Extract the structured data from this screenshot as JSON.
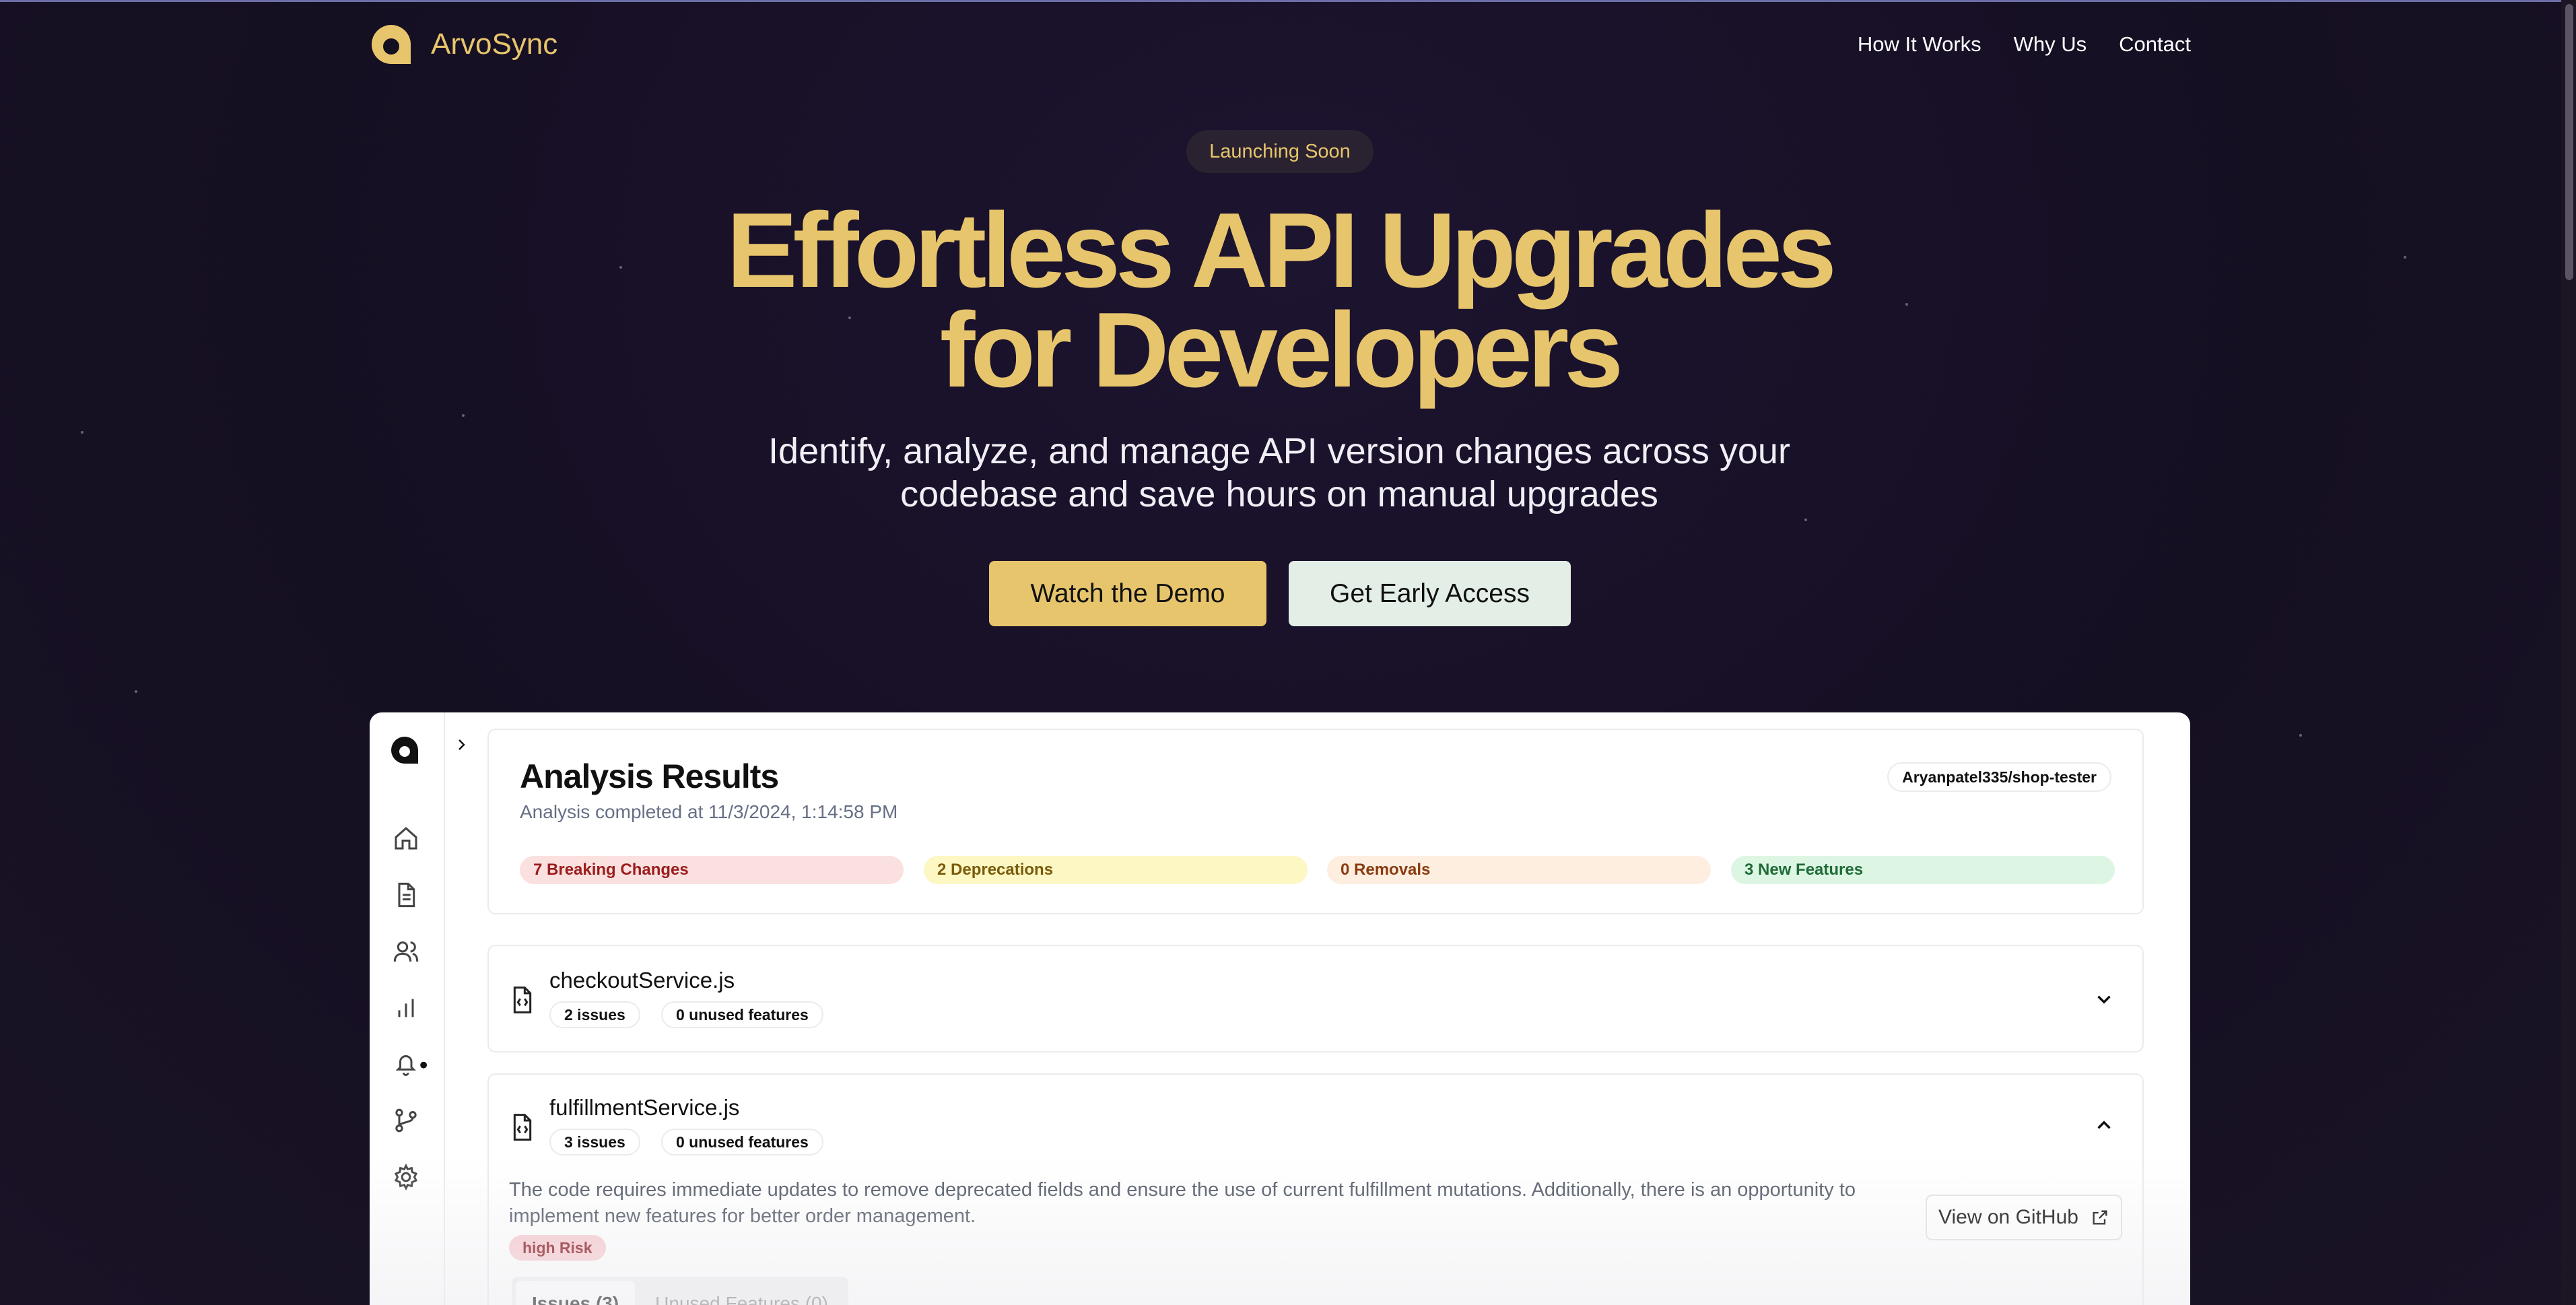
{
  "brand": {
    "name": "ArvoSync",
    "logo_icon": "arvosync-logo-icon",
    "accent": "#e7c56c"
  },
  "nav": {
    "links": [
      "How It Works",
      "Why Us",
      "Contact"
    ]
  },
  "hero": {
    "badge": "Launching Soon",
    "headline_line1": "Effortless API Upgrades",
    "headline_line2": "for Developers",
    "subline_line1": "Identify, analyze, and manage API version changes across your",
    "subline_line2": "codebase and save hours on manual upgrades",
    "cta_primary": "Watch the Demo",
    "cta_secondary": "Get Early Access"
  },
  "app": {
    "sidebar_icons": [
      "home-icon",
      "document-icon",
      "users-icon",
      "bar-chart-icon",
      "bell-icon",
      "git-branch-icon",
      "gear-icon"
    ],
    "results": {
      "title": "Analysis Results",
      "subtitle": "Analysis completed at 11/3/2024, 1:14:58 PM",
      "repo": "Aryanpatel335/shop-tester",
      "stats": {
        "breaking": "7 Breaking Changes",
        "deprecations": "2 Deprecations",
        "removals": "0 Removals",
        "new_features": "3 New Features"
      }
    },
    "files": [
      {
        "name": "checkoutService.js",
        "issues": "2 issues",
        "unused": "0 unused features",
        "expanded": false
      },
      {
        "name": "fulfillmentService.js",
        "issues": "3 issues",
        "unused": "0 unused features",
        "expanded": true,
        "description_line1": "The code requires immediate updates to remove deprecated fields and ensure the use of current fulfillment mutations. Additionally, there is an opportunity to",
        "description_line2": "implement new features for better order management.",
        "risk": "high Risk",
        "github_button": "View on GitHub",
        "tabs": [
          "Issues (3)",
          "Unused Features (0)"
        ]
      }
    ]
  }
}
